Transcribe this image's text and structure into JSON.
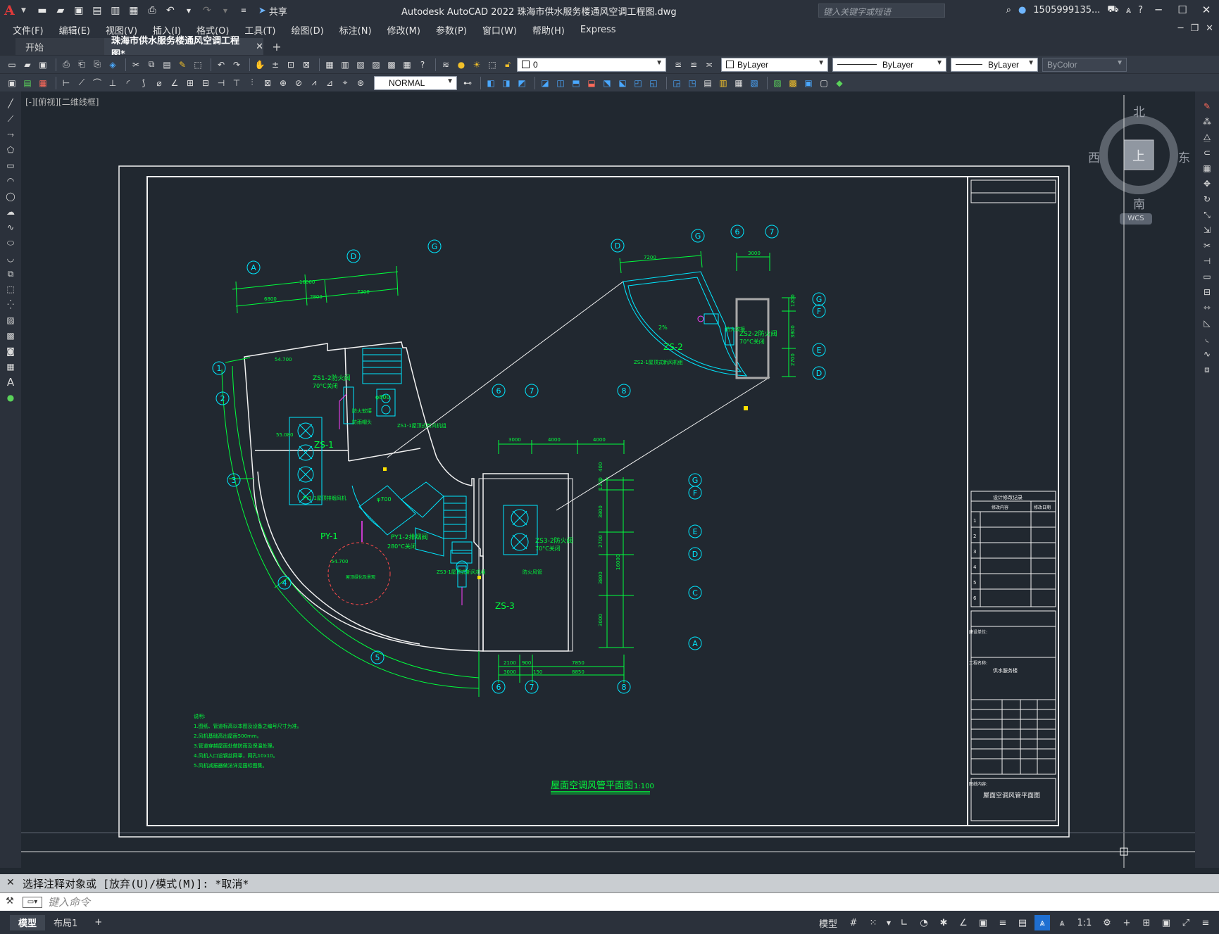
{
  "app": {
    "title": "Autodesk AutoCAD 2022    珠海市供水服务楼通风空调工程图.dwg",
    "logo": "A",
    "share_label": "共享",
    "search_placeholder": "键入关键字或短语",
    "user": "1505999135...",
    "help": "?"
  },
  "menu": [
    "文件(F)",
    "编辑(E)",
    "视图(V)",
    "插入(I)",
    "格式(O)",
    "工具(T)",
    "绘图(D)",
    "标注(N)",
    "修改(M)",
    "参数(P)",
    "窗口(W)",
    "帮助(H)",
    "Express"
  ],
  "tabs": {
    "start": "开始",
    "active": "珠海市供水服务楼通风空调工程图*",
    "close": "✕",
    "add": "+"
  },
  "toolbar": {
    "layer_value": "0",
    "color_value": "ByLayer",
    "linetype_value": "ByLayer",
    "lineweight_value": "ByLayer",
    "plotstyle_value": "ByColor",
    "dimstyle_value": "NORMAL"
  },
  "viewport": {
    "label": "[-][俯视][二维线框]",
    "compass": {
      "north": "北",
      "south": "南",
      "east": "东",
      "west": "西",
      "top": "上"
    },
    "wcs": "WCS"
  },
  "drawing": {
    "title": "屋面空调风管平面图",
    "scale": "1:100",
    "colors": {
      "green": "#00ff3c",
      "cyan": "#00e8ff",
      "white": "#f2f2f2",
      "magenta": "#ff40ff",
      "red": "#ff4a4a",
      "yellow": "#ffe200"
    },
    "grid_bubbles": {
      "top_main": [
        "A",
        "D",
        "G"
      ],
      "left_main": [
        "1",
        "2",
        "3",
        "4",
        "5"
      ],
      "bottom_main": [
        "6",
        "7",
        "8"
      ],
      "mid_row": [
        "6",
        "7",
        "8"
      ],
      "right_main": [
        "G",
        "F",
        "E",
        "D",
        "C",
        "A"
      ],
      "inset_top": [
        "D",
        "G",
        "6",
        "7"
      ],
      "inset_right": [
        "G",
        "F",
        "E",
        "D"
      ]
    },
    "dims": {
      "top_total": "16000",
      "top_a": "6800",
      "top_b": "2800",
      "top_c": "7200",
      "inset_a": "7200",
      "inset_b": "3000",
      "mid_a": "3000",
      "mid_b": "4000",
      "mid_c": "4000",
      "bot_a": "2100",
      "bot_b": "900",
      "bot_c": "7850",
      "bot_d": "3000",
      "bot_e": "150",
      "bot_f": "8850",
      "right_total": "16000",
      "right_a": "1200",
      "right_b": "3800",
      "right_c": "2700",
      "right_d": "3800",
      "right_e": "3000",
      "elev_a": "54.700",
      "elev_b": "55.080",
      "elev_c": "54.700"
    },
    "zones": [
      "ZS-1",
      "ZS-2",
      "ZS-3",
      "PY-1"
    ],
    "valves": {
      "zs1": "ZS1-2防火阀",
      "zs2": "ZS2-2防火阀",
      "zs3": "ZS3-2防火阀",
      "py1": "PY1-2排烟阀",
      "temp70": "70°C关闭",
      "temp280": "280°C关闭"
    },
    "fans": {
      "zs1": "ZS1-1屋顶式新风机组",
      "zs2": "ZS2-1屋顶式新风机组",
      "zs3": "ZS3-1屋顶式新风机组",
      "py1": "PY1-1屋顶排烟风机"
    },
    "labels": {
      "duct_a": "φ800",
      "duct_b": "φ700",
      "slope": "2%",
      "fire_damper": "防火软接",
      "rain_cap": "防雨帽头",
      "plant": "屋顶绿化及景观",
      "bullet_hole": "防火风管"
    },
    "notes": {
      "head": "说明:",
      "lines": [
        "1.图纸、管道标高以本图及设备之编号尺寸为准。",
        "2.风机基础高出屋面500mm。",
        "3.管道穿越屋面处做防雨及保温处理。",
        "4.风机入口设钢丝网罩，网孔10x10。",
        "5.风机减振器做法详见国标图集。"
      ]
    },
    "titleblock": {
      "revision_title": "设计修改记录",
      "revision_col1": "修改内容",
      "revision_col2": "修改日期",
      "revision_rows": [
        "1",
        "2",
        "3",
        "4",
        "5",
        "6"
      ],
      "client_label": "建设单位:",
      "project_label": "工程名称:",
      "project_name": "供水服务楼",
      "drawing_label": "图纸内容:",
      "drawing_name": "屋面空调风管平面图"
    }
  },
  "command": {
    "history": "选择注释对象或 [放弃(U)/模式(M)]: *取消*",
    "placeholder": "键入命令"
  },
  "status": {
    "model_tab": "模型",
    "layout_tab": "布局1",
    "add_tab": "+",
    "model_label": "模型",
    "scale": "1:1"
  }
}
